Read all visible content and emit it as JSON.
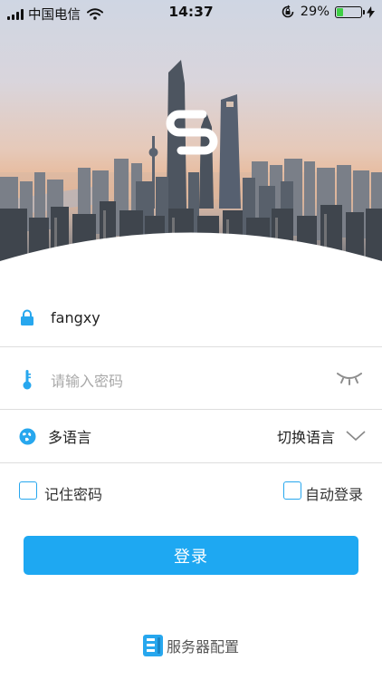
{
  "status_bar": {
    "carrier": "中国电信",
    "time": "14:37",
    "battery_percent": "29%",
    "battery_level": 0.29,
    "icons": [
      "signal-icon",
      "wifi-icon",
      "rotation-lock-icon",
      "battery-icon",
      "charging-icon"
    ]
  },
  "logo": {
    "icon": "app-logo-icon"
  },
  "username": {
    "value": "fangxy",
    "icon": "lock-icon"
  },
  "password": {
    "placeholder": "请输入密码",
    "icon": "key-icon",
    "toggle_icon": "eye-closed-icon"
  },
  "language": {
    "label": "多语言",
    "switch_label": "切换语言",
    "icon": "globe-icon",
    "chevron_icon": "chevron-down-icon"
  },
  "options": {
    "remember_password": "记住密码",
    "auto_login": "自动登录"
  },
  "login_button": "登录",
  "server_config": {
    "label": "服务器配置",
    "icon": "server-icon"
  },
  "colors": {
    "accent": "#1ea8f2",
    "divider": "#dedede",
    "placeholder": "#a9a9a9"
  }
}
